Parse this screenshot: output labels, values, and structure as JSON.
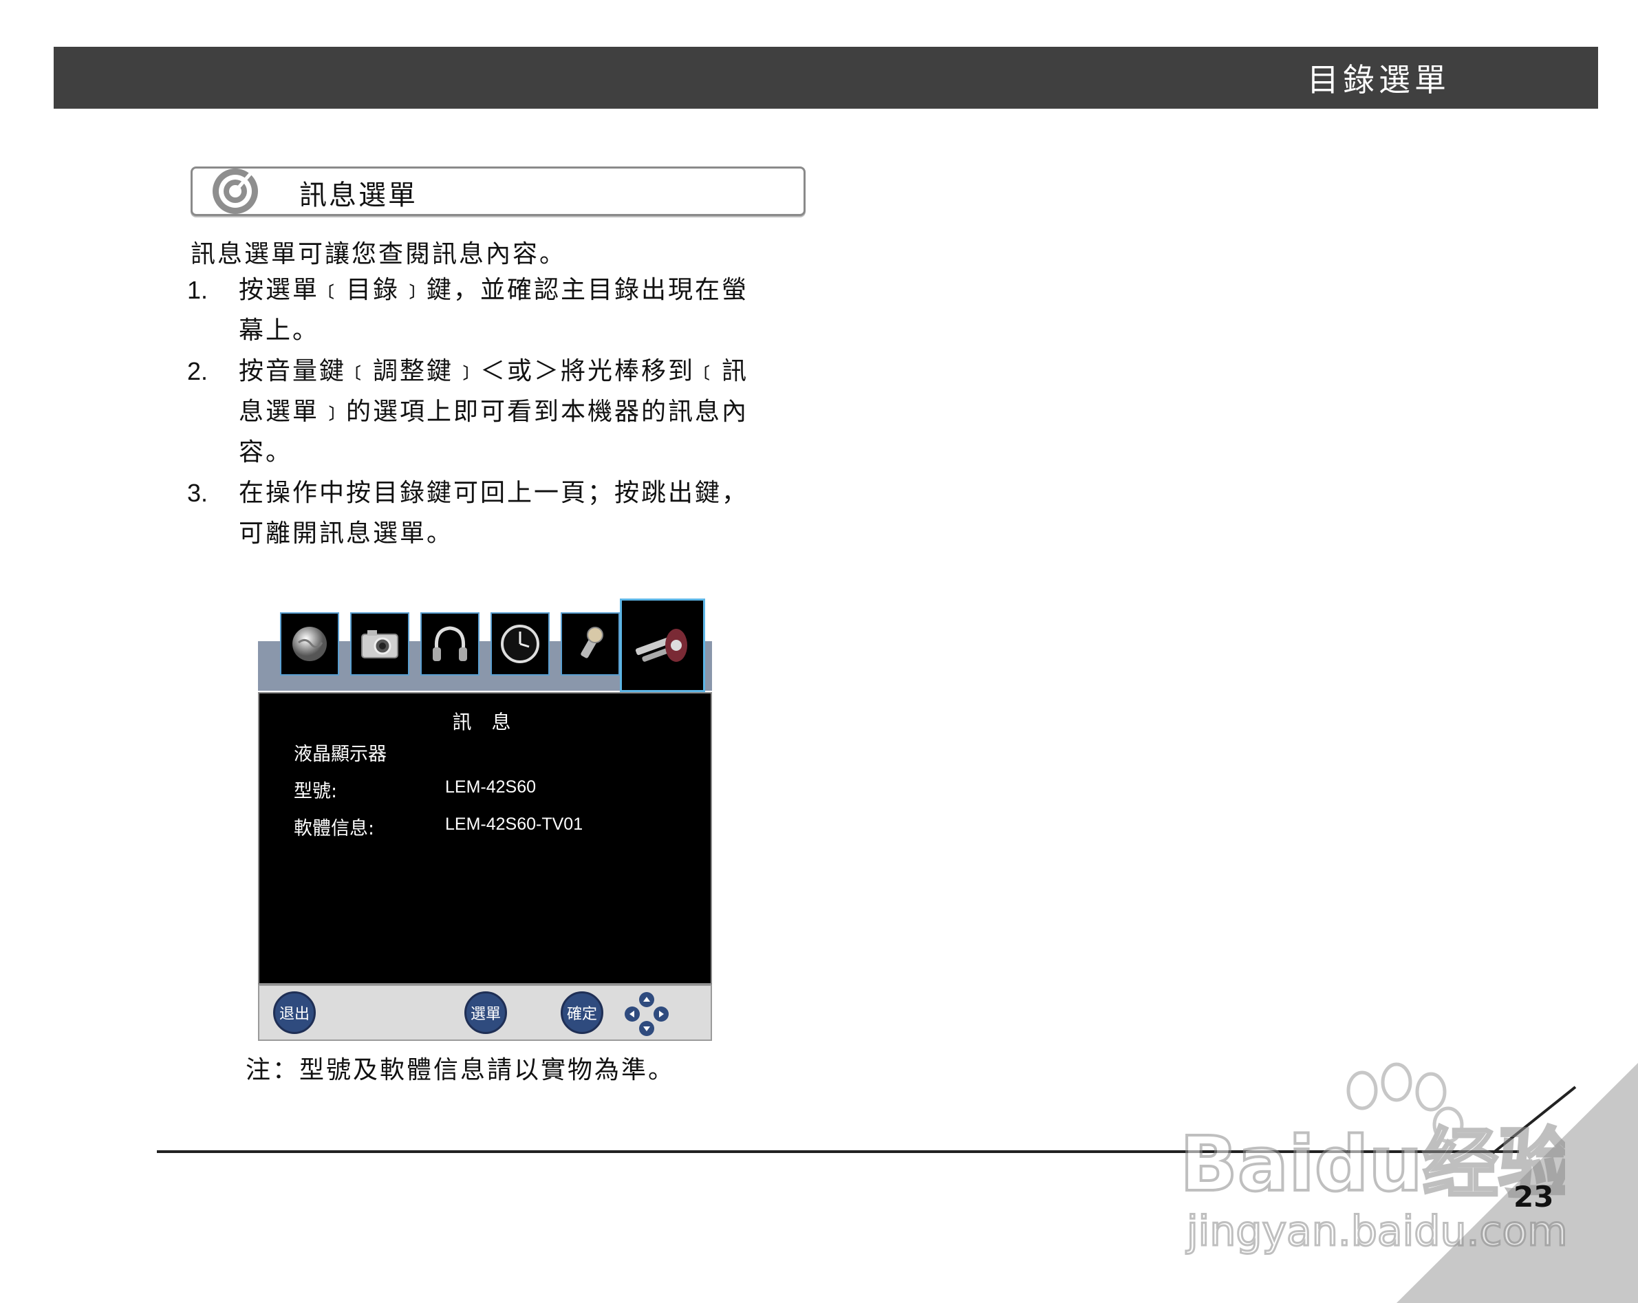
{
  "header": {
    "title": "目錄選單"
  },
  "section": {
    "title": "訊息選單",
    "icon": "target-icon"
  },
  "intro": "訊息選單可讓您查閱訊息內容。",
  "steps": [
    {
      "num": "1.",
      "lines": [
        "按選單﹝目錄﹞鍵，並確認主目錄出現在螢",
        "幕上。"
      ]
    },
    {
      "num": "2.",
      "lines": [
        "按音量鍵﹝調整鍵﹞＜或＞將光棒移到﹝訊",
        "息選單﹞的選項上即可看到本機器的訊息內",
        "容。"
      ]
    },
    {
      "num": "3.",
      "lines": [
        "在操作中按目錄鍵可回上一頁；按跳出鍵，",
        "可離開訊息選單。"
      ]
    }
  ],
  "osd": {
    "tabs": [
      "picture-icon",
      "camera-icon",
      "headphones-icon",
      "clock-icon",
      "setup-icon",
      "info-icon"
    ],
    "active_tab": 5,
    "title": "訊 息",
    "product": "液晶顯示器",
    "model_label": "型號:",
    "model_value": "LEM-42S60",
    "software_label": "軟體信息:",
    "software_value": "LEM-42S60-TV01",
    "footer": {
      "exit": "退出",
      "menu": "選單",
      "ok": "確定",
      "nav": "dpad-icon"
    }
  },
  "note": "注：型號及軟體信息請以實物為準。",
  "page_number": "23",
  "watermark": {
    "brand": "Baidu经验",
    "url": "jingyan.baidu.com"
  }
}
